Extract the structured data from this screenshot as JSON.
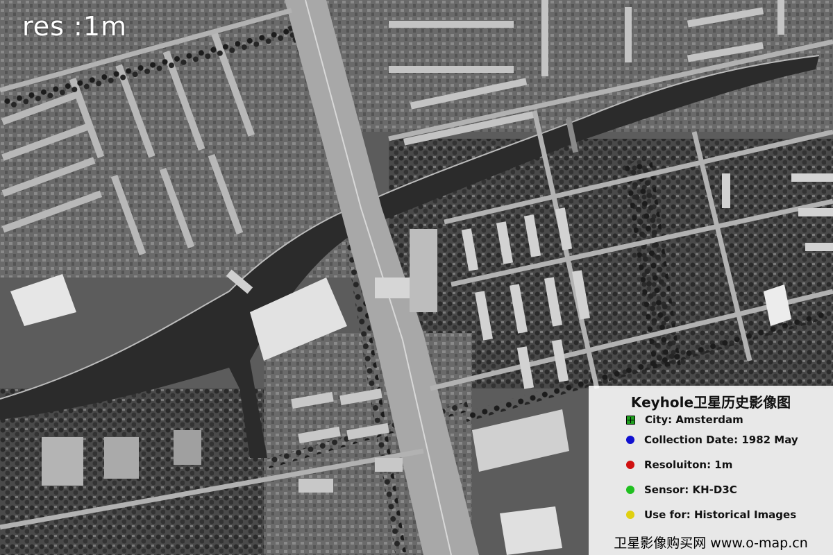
{
  "map": {
    "resolution_label": "res :1m"
  },
  "legend": {
    "title": "Keyhole卫星历史影像图",
    "items": [
      {
        "text": "City: Amsterdam",
        "marker_color": "#1e9e1e",
        "marker_shape": "square-plus"
      },
      {
        "text": "Collection Date: 1982 May",
        "marker_color": "#1010d0",
        "marker_shape": "circle"
      },
      {
        "text": "Resoluiton: 1m",
        "marker_color": "#d01010",
        "marker_shape": "circle"
      },
      {
        "text": "Sensor: KH-D3C",
        "marker_color": "#20c020",
        "marker_shape": "circle"
      },
      {
        "text": "Use for: Historical Images",
        "marker_color": "#e0d010",
        "marker_shape": "circle"
      }
    ],
    "footer": "卫星影像购买网 www.o-map.cn"
  }
}
